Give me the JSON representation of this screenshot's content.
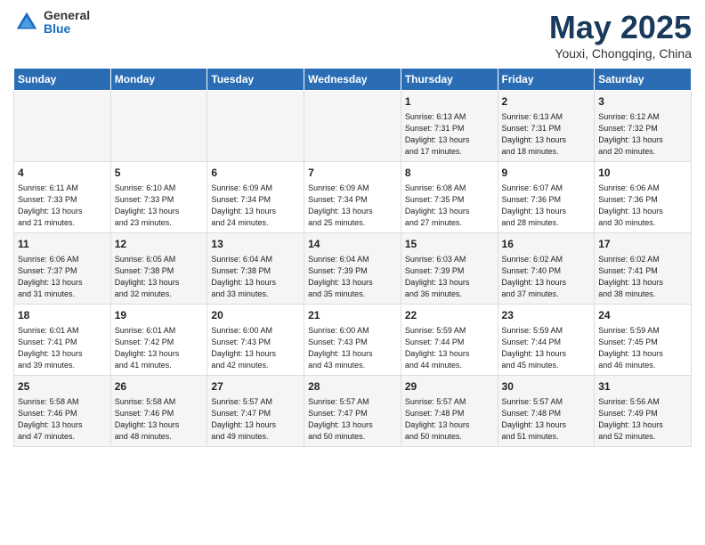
{
  "logo": {
    "general": "General",
    "blue": "Blue"
  },
  "title": "May 2025",
  "location": "Youxi, Chongqing, China",
  "days_of_week": [
    "Sunday",
    "Monday",
    "Tuesday",
    "Wednesday",
    "Thursday",
    "Friday",
    "Saturday"
  ],
  "weeks": [
    [
      {
        "day": "",
        "info": ""
      },
      {
        "day": "",
        "info": ""
      },
      {
        "day": "",
        "info": ""
      },
      {
        "day": "",
        "info": ""
      },
      {
        "day": "1",
        "info": "Sunrise: 6:13 AM\nSunset: 7:31 PM\nDaylight: 13 hours\nand 17 minutes."
      },
      {
        "day": "2",
        "info": "Sunrise: 6:13 AM\nSunset: 7:31 PM\nDaylight: 13 hours\nand 18 minutes."
      },
      {
        "day": "3",
        "info": "Sunrise: 6:12 AM\nSunset: 7:32 PM\nDaylight: 13 hours\nand 20 minutes."
      }
    ],
    [
      {
        "day": "4",
        "info": "Sunrise: 6:11 AM\nSunset: 7:33 PM\nDaylight: 13 hours\nand 21 minutes."
      },
      {
        "day": "5",
        "info": "Sunrise: 6:10 AM\nSunset: 7:33 PM\nDaylight: 13 hours\nand 23 minutes."
      },
      {
        "day": "6",
        "info": "Sunrise: 6:09 AM\nSunset: 7:34 PM\nDaylight: 13 hours\nand 24 minutes."
      },
      {
        "day": "7",
        "info": "Sunrise: 6:09 AM\nSunset: 7:34 PM\nDaylight: 13 hours\nand 25 minutes."
      },
      {
        "day": "8",
        "info": "Sunrise: 6:08 AM\nSunset: 7:35 PM\nDaylight: 13 hours\nand 27 minutes."
      },
      {
        "day": "9",
        "info": "Sunrise: 6:07 AM\nSunset: 7:36 PM\nDaylight: 13 hours\nand 28 minutes."
      },
      {
        "day": "10",
        "info": "Sunrise: 6:06 AM\nSunset: 7:36 PM\nDaylight: 13 hours\nand 30 minutes."
      }
    ],
    [
      {
        "day": "11",
        "info": "Sunrise: 6:06 AM\nSunset: 7:37 PM\nDaylight: 13 hours\nand 31 minutes."
      },
      {
        "day": "12",
        "info": "Sunrise: 6:05 AM\nSunset: 7:38 PM\nDaylight: 13 hours\nand 32 minutes."
      },
      {
        "day": "13",
        "info": "Sunrise: 6:04 AM\nSunset: 7:38 PM\nDaylight: 13 hours\nand 33 minutes."
      },
      {
        "day": "14",
        "info": "Sunrise: 6:04 AM\nSunset: 7:39 PM\nDaylight: 13 hours\nand 35 minutes."
      },
      {
        "day": "15",
        "info": "Sunrise: 6:03 AM\nSunset: 7:39 PM\nDaylight: 13 hours\nand 36 minutes."
      },
      {
        "day": "16",
        "info": "Sunrise: 6:02 AM\nSunset: 7:40 PM\nDaylight: 13 hours\nand 37 minutes."
      },
      {
        "day": "17",
        "info": "Sunrise: 6:02 AM\nSunset: 7:41 PM\nDaylight: 13 hours\nand 38 minutes."
      }
    ],
    [
      {
        "day": "18",
        "info": "Sunrise: 6:01 AM\nSunset: 7:41 PM\nDaylight: 13 hours\nand 39 minutes."
      },
      {
        "day": "19",
        "info": "Sunrise: 6:01 AM\nSunset: 7:42 PM\nDaylight: 13 hours\nand 41 minutes."
      },
      {
        "day": "20",
        "info": "Sunrise: 6:00 AM\nSunset: 7:43 PM\nDaylight: 13 hours\nand 42 minutes."
      },
      {
        "day": "21",
        "info": "Sunrise: 6:00 AM\nSunset: 7:43 PM\nDaylight: 13 hours\nand 43 minutes."
      },
      {
        "day": "22",
        "info": "Sunrise: 5:59 AM\nSunset: 7:44 PM\nDaylight: 13 hours\nand 44 minutes."
      },
      {
        "day": "23",
        "info": "Sunrise: 5:59 AM\nSunset: 7:44 PM\nDaylight: 13 hours\nand 45 minutes."
      },
      {
        "day": "24",
        "info": "Sunrise: 5:59 AM\nSunset: 7:45 PM\nDaylight: 13 hours\nand 46 minutes."
      }
    ],
    [
      {
        "day": "25",
        "info": "Sunrise: 5:58 AM\nSunset: 7:46 PM\nDaylight: 13 hours\nand 47 minutes."
      },
      {
        "day": "26",
        "info": "Sunrise: 5:58 AM\nSunset: 7:46 PM\nDaylight: 13 hours\nand 48 minutes."
      },
      {
        "day": "27",
        "info": "Sunrise: 5:57 AM\nSunset: 7:47 PM\nDaylight: 13 hours\nand 49 minutes."
      },
      {
        "day": "28",
        "info": "Sunrise: 5:57 AM\nSunset: 7:47 PM\nDaylight: 13 hours\nand 50 minutes."
      },
      {
        "day": "29",
        "info": "Sunrise: 5:57 AM\nSunset: 7:48 PM\nDaylight: 13 hours\nand 50 minutes."
      },
      {
        "day": "30",
        "info": "Sunrise: 5:57 AM\nSunset: 7:48 PM\nDaylight: 13 hours\nand 51 minutes."
      },
      {
        "day": "31",
        "info": "Sunrise: 5:56 AM\nSunset: 7:49 PM\nDaylight: 13 hours\nand 52 minutes."
      }
    ]
  ]
}
